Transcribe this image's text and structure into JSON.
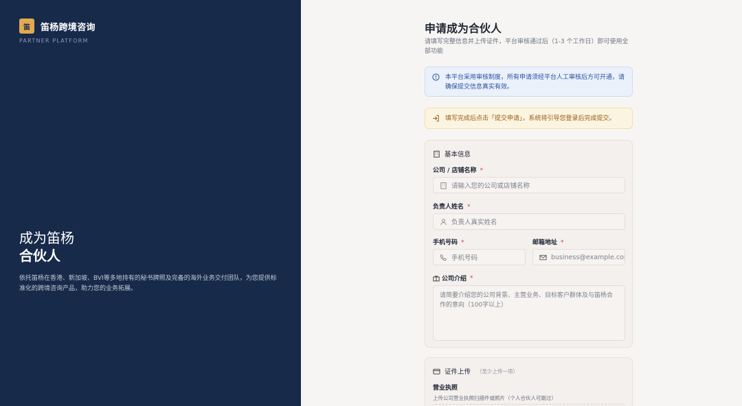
{
  "brand": {
    "logo_char": "笛",
    "name": "笛杨跨境咨询",
    "subtitle": "PARTNER PLATFORM"
  },
  "hero": {
    "title_line1": "成为笛杨",
    "title_line2": "合伙人",
    "description": "依托笛杨在香港、新加坡、BVI等多地持有的秘书牌照及完备的海外业务交付团队，为您提供标准化的跨境咨询产品，助力您的业务拓展。"
  },
  "page": {
    "title": "申请成为合伙人",
    "subtitle": "请填写完整信息并上传证件，平台审核通过后（1-3 个工作日）即可使用全部功能"
  },
  "notices": {
    "info": "本平台采用审核制度，所有申请须经平台人工审核后方可开通，请确保提交信息真实有效。",
    "warning": "填写完成后点击「提交申请」，系统将引导您登录后完成提交。"
  },
  "basic_info": {
    "section_title": "基本信息",
    "company_label": "公司 / 店铺名称",
    "company_placeholder": "请输入您的公司或店铺名称",
    "name_label": "负责人姓名",
    "name_placeholder": "负责人真实姓名",
    "phone_label": "手机号码",
    "phone_placeholder": "手机号码",
    "email_label": "邮箱地址",
    "email_placeholder": "business@example.com",
    "intro_label": "公司介绍",
    "intro_placeholder": "请简要介绍您的公司背景、主营业务、目标客户群体及与笛杨合作的意向（100字以上）",
    "required_mark": "*"
  },
  "documents": {
    "section_title": "证件上传",
    "section_hint": "（至少上传一项）",
    "license_label": "营业执照",
    "license_desc": "上传公司营业执照扫描件或照片（个人合伙人可跳过）"
  },
  "colors": {
    "sidebar_bg": "#172a4a",
    "accent_gold": "#e3a94f",
    "info_blue": "#2b4fa0",
    "warning_amber": "#9a5a12",
    "required_red": "#d23c3c"
  }
}
